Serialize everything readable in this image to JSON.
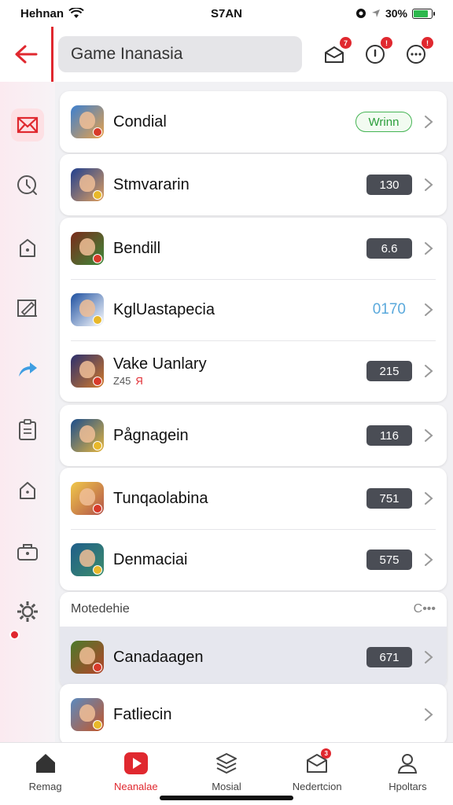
{
  "status_bar": {
    "carrier": "Hehnan",
    "time": "S7AN",
    "battery": "30%",
    "battery_level": 0.8
  },
  "search": {
    "value": "Game Inanasia"
  },
  "top_actions": [
    {
      "icon": "mail-icon",
      "badge": "7"
    },
    {
      "icon": "info-icon",
      "badge": "!"
    },
    {
      "icon": "chat-icon",
      "badge": "!"
    }
  ],
  "sidebar": {
    "items": [
      "mail-icon",
      "clock-icon",
      "bag-icon",
      "edit-icon",
      "share-icon",
      "clipboard-icon",
      "store-icon",
      "briefcase-icon",
      "settings-icon"
    ]
  },
  "groups": [
    [
      {
        "name": "Condial",
        "value": "Wrinn",
        "style": "outline"
      }
    ],
    [
      {
        "name": "Stmvararin",
        "value": "130",
        "style": "dark"
      }
    ],
    [
      {
        "name": "Bendill",
        "value": "6.6",
        "style": "dark"
      },
      {
        "name": "KglUastapecia",
        "value": "0170",
        "style": "plain"
      },
      {
        "name": "Vake Uanlary",
        "sub": "Z45",
        "sub_red": "Я",
        "value": "215",
        "style": "dark"
      }
    ],
    [
      {
        "name": "Pågnagein",
        "value": "116",
        "style": "dark"
      }
    ],
    [
      {
        "name": "Tunqaolabina",
        "value": "751",
        "style": "dark"
      },
      {
        "name": "Denmaciai",
        "value": "575",
        "style": "dark"
      }
    ]
  ],
  "section": {
    "title": "Motedehie",
    "more": "C•••",
    "items": [
      {
        "name": "Canadaagen",
        "value": "671",
        "style": "dark"
      },
      {
        "name": "Fatliecin"
      }
    ]
  },
  "bottom_nav": [
    {
      "label": "Remag",
      "icon": "home-icon"
    },
    {
      "label": "Neanalae",
      "icon": "play-icon"
    },
    {
      "label": "Mosial",
      "icon": "stack-icon"
    },
    {
      "label": "Nedertcion",
      "icon": "mail-icon",
      "badge": "3"
    },
    {
      "label": "Hpoltars",
      "icon": "person-icon"
    }
  ],
  "colors": {
    "accent": "#e0282f",
    "pill_dark": "#4a4d55",
    "green": "#45b454",
    "blue": "#5aa9dc"
  }
}
